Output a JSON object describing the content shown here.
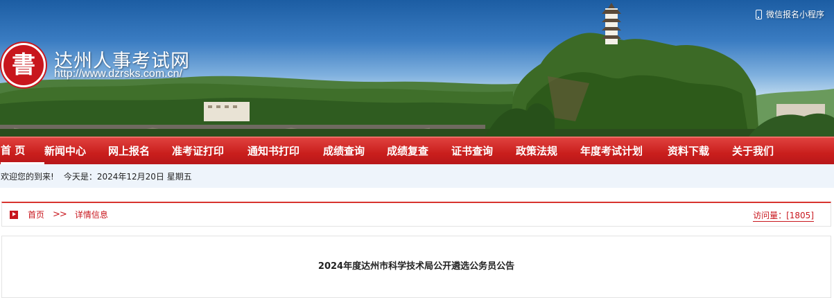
{
  "header": {
    "logo_char": "書",
    "site_title": "达州人事考试网",
    "site_url": "http://www.dzrsks.com.cn/",
    "wechat_label": "微信报名小程序"
  },
  "nav": {
    "items": [
      {
        "label": "首 页"
      },
      {
        "label": "新闻中心"
      },
      {
        "label": "网上报名"
      },
      {
        "label": "准考证打印"
      },
      {
        "label": "通知书打印"
      },
      {
        "label": "成绩查询"
      },
      {
        "label": "成绩复查"
      },
      {
        "label": "证书查询"
      },
      {
        "label": "政策法规"
      },
      {
        "label": "年度考试计划"
      },
      {
        "label": "资料下载"
      },
      {
        "label": "关于我们"
      }
    ]
  },
  "welcome": {
    "greeting": "欢迎您的到来!",
    "date": "今天是：2024年12月20日 星期五"
  },
  "breadcrumb": {
    "home": "首页",
    "separator": ">>",
    "current": "详情信息",
    "visits": "访问量：[1805]"
  },
  "article": {
    "title": "2024年度达州市科学技术局公开遴选公务员公告"
  },
  "colors": {
    "brand_red": "#c8161d",
    "nav_red": "#d0262a",
    "welcome_bg": "#eef4fb"
  }
}
